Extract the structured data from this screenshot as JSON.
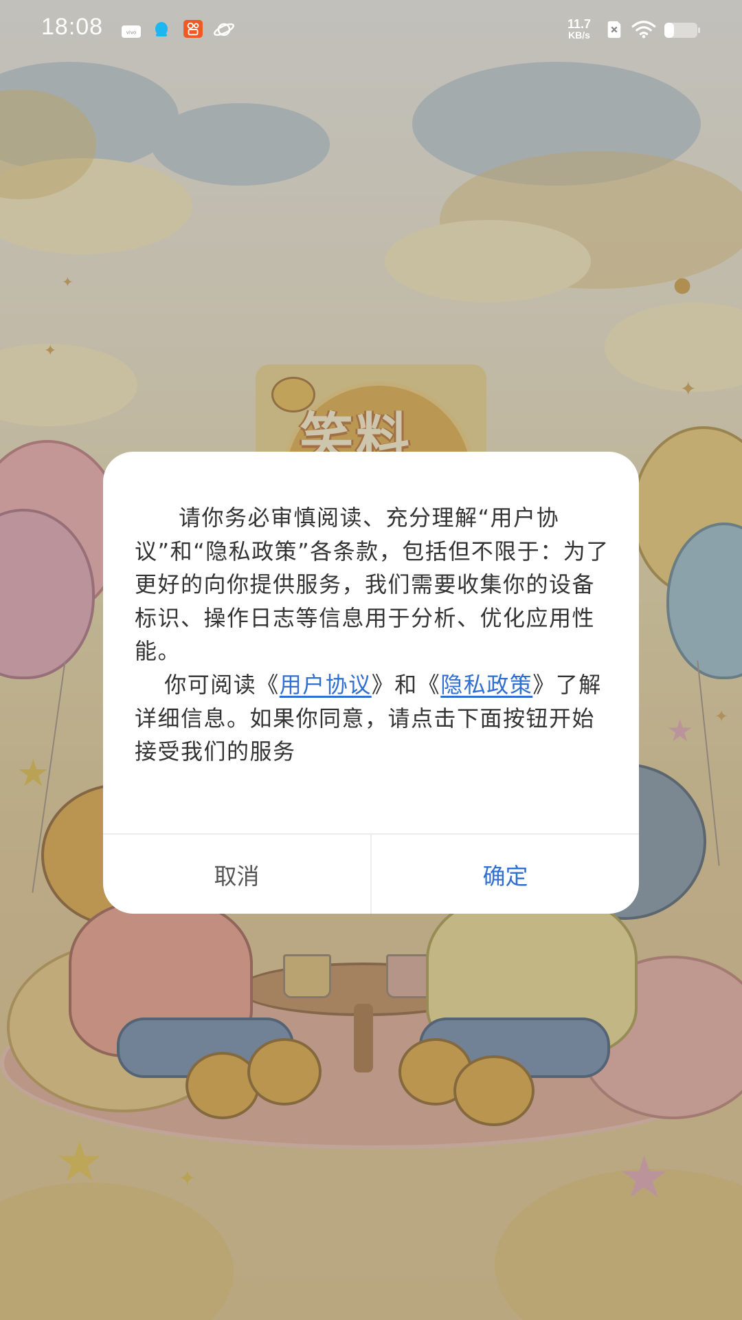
{
  "status_bar": {
    "time": "18:08",
    "net_speed_value": "11.7",
    "net_speed_unit": "KB/s",
    "icons": [
      "vivo-icon",
      "qq-icon",
      "kuaishou-icon",
      "saturn-icon",
      "sim-off-icon",
      "wifi-icon",
      "battery-icon"
    ]
  },
  "background": {
    "logo_text": "笑料"
  },
  "dialog": {
    "paragraph1": "请你务必审慎阅读、充分理解“用户协议”和“隐私政策”各条款，包括但不限于：为了更好的向你提供服务，我们需要收集你的设备标识、操作日志等信息用于分析、优化应用性能。",
    "p2_prefix": "你可阅读《",
    "user_agreement_link": "用户协议",
    "p2_middle": "》和《",
    "privacy_policy_link": "隐私政策",
    "p2_suffix": "》了解详细信息。如果你同意，请点击下面按钮开始接受我们的服务",
    "cancel_label": "取消",
    "confirm_label": "确定"
  },
  "colors": {
    "accent": "#2f6fd1",
    "dialog_bg": "#ffffff",
    "body_text": "#333333"
  }
}
